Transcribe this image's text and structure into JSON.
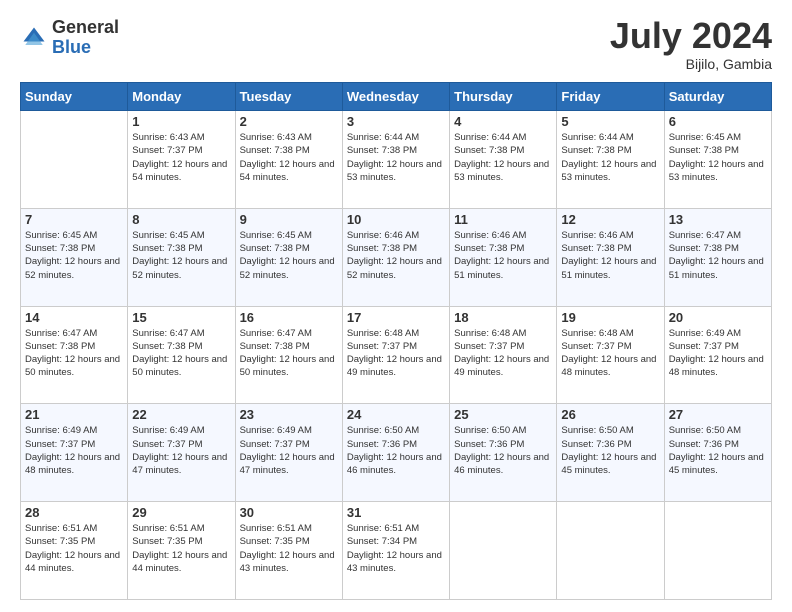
{
  "logo": {
    "general": "General",
    "blue": "Blue"
  },
  "header": {
    "title": "July 2024",
    "subtitle": "Bijilo, Gambia"
  },
  "days_of_week": [
    "Sunday",
    "Monday",
    "Tuesday",
    "Wednesday",
    "Thursday",
    "Friday",
    "Saturday"
  ],
  "weeks": [
    [
      {
        "day": "",
        "sunrise": "",
        "sunset": "",
        "daylight": ""
      },
      {
        "day": "1",
        "sunrise": "Sunrise: 6:43 AM",
        "sunset": "Sunset: 7:37 PM",
        "daylight": "Daylight: 12 hours and 54 minutes."
      },
      {
        "day": "2",
        "sunrise": "Sunrise: 6:43 AM",
        "sunset": "Sunset: 7:38 PM",
        "daylight": "Daylight: 12 hours and 54 minutes."
      },
      {
        "day": "3",
        "sunrise": "Sunrise: 6:44 AM",
        "sunset": "Sunset: 7:38 PM",
        "daylight": "Daylight: 12 hours and 53 minutes."
      },
      {
        "day": "4",
        "sunrise": "Sunrise: 6:44 AM",
        "sunset": "Sunset: 7:38 PM",
        "daylight": "Daylight: 12 hours and 53 minutes."
      },
      {
        "day": "5",
        "sunrise": "Sunrise: 6:44 AM",
        "sunset": "Sunset: 7:38 PM",
        "daylight": "Daylight: 12 hours and 53 minutes."
      },
      {
        "day": "6",
        "sunrise": "Sunrise: 6:45 AM",
        "sunset": "Sunset: 7:38 PM",
        "daylight": "Daylight: 12 hours and 53 minutes."
      }
    ],
    [
      {
        "day": "7",
        "sunrise": "Sunrise: 6:45 AM",
        "sunset": "Sunset: 7:38 PM",
        "daylight": "Daylight: 12 hours and 52 minutes."
      },
      {
        "day": "8",
        "sunrise": "Sunrise: 6:45 AM",
        "sunset": "Sunset: 7:38 PM",
        "daylight": "Daylight: 12 hours and 52 minutes."
      },
      {
        "day": "9",
        "sunrise": "Sunrise: 6:45 AM",
        "sunset": "Sunset: 7:38 PM",
        "daylight": "Daylight: 12 hours and 52 minutes."
      },
      {
        "day": "10",
        "sunrise": "Sunrise: 6:46 AM",
        "sunset": "Sunset: 7:38 PM",
        "daylight": "Daylight: 12 hours and 52 minutes."
      },
      {
        "day": "11",
        "sunrise": "Sunrise: 6:46 AM",
        "sunset": "Sunset: 7:38 PM",
        "daylight": "Daylight: 12 hours and 51 minutes."
      },
      {
        "day": "12",
        "sunrise": "Sunrise: 6:46 AM",
        "sunset": "Sunset: 7:38 PM",
        "daylight": "Daylight: 12 hours and 51 minutes."
      },
      {
        "day": "13",
        "sunrise": "Sunrise: 6:47 AM",
        "sunset": "Sunset: 7:38 PM",
        "daylight": "Daylight: 12 hours and 51 minutes."
      }
    ],
    [
      {
        "day": "14",
        "sunrise": "Sunrise: 6:47 AM",
        "sunset": "Sunset: 7:38 PM",
        "daylight": "Daylight: 12 hours and 50 minutes."
      },
      {
        "day": "15",
        "sunrise": "Sunrise: 6:47 AM",
        "sunset": "Sunset: 7:38 PM",
        "daylight": "Daylight: 12 hours and 50 minutes."
      },
      {
        "day": "16",
        "sunrise": "Sunrise: 6:47 AM",
        "sunset": "Sunset: 7:38 PM",
        "daylight": "Daylight: 12 hours and 50 minutes."
      },
      {
        "day": "17",
        "sunrise": "Sunrise: 6:48 AM",
        "sunset": "Sunset: 7:37 PM",
        "daylight": "Daylight: 12 hours and 49 minutes."
      },
      {
        "day": "18",
        "sunrise": "Sunrise: 6:48 AM",
        "sunset": "Sunset: 7:37 PM",
        "daylight": "Daylight: 12 hours and 49 minutes."
      },
      {
        "day": "19",
        "sunrise": "Sunrise: 6:48 AM",
        "sunset": "Sunset: 7:37 PM",
        "daylight": "Daylight: 12 hours and 48 minutes."
      },
      {
        "day": "20",
        "sunrise": "Sunrise: 6:49 AM",
        "sunset": "Sunset: 7:37 PM",
        "daylight": "Daylight: 12 hours and 48 minutes."
      }
    ],
    [
      {
        "day": "21",
        "sunrise": "Sunrise: 6:49 AM",
        "sunset": "Sunset: 7:37 PM",
        "daylight": "Daylight: 12 hours and 48 minutes."
      },
      {
        "day": "22",
        "sunrise": "Sunrise: 6:49 AM",
        "sunset": "Sunset: 7:37 PM",
        "daylight": "Daylight: 12 hours and 47 minutes."
      },
      {
        "day": "23",
        "sunrise": "Sunrise: 6:49 AM",
        "sunset": "Sunset: 7:37 PM",
        "daylight": "Daylight: 12 hours and 47 minutes."
      },
      {
        "day": "24",
        "sunrise": "Sunrise: 6:50 AM",
        "sunset": "Sunset: 7:36 PM",
        "daylight": "Daylight: 12 hours and 46 minutes."
      },
      {
        "day": "25",
        "sunrise": "Sunrise: 6:50 AM",
        "sunset": "Sunset: 7:36 PM",
        "daylight": "Daylight: 12 hours and 46 minutes."
      },
      {
        "day": "26",
        "sunrise": "Sunrise: 6:50 AM",
        "sunset": "Sunset: 7:36 PM",
        "daylight": "Daylight: 12 hours and 45 minutes."
      },
      {
        "day": "27",
        "sunrise": "Sunrise: 6:50 AM",
        "sunset": "Sunset: 7:36 PM",
        "daylight": "Daylight: 12 hours and 45 minutes."
      }
    ],
    [
      {
        "day": "28",
        "sunrise": "Sunrise: 6:51 AM",
        "sunset": "Sunset: 7:35 PM",
        "daylight": "Daylight: 12 hours and 44 minutes."
      },
      {
        "day": "29",
        "sunrise": "Sunrise: 6:51 AM",
        "sunset": "Sunset: 7:35 PM",
        "daylight": "Daylight: 12 hours and 44 minutes."
      },
      {
        "day": "30",
        "sunrise": "Sunrise: 6:51 AM",
        "sunset": "Sunset: 7:35 PM",
        "daylight": "Daylight: 12 hours and 43 minutes."
      },
      {
        "day": "31",
        "sunrise": "Sunrise: 6:51 AM",
        "sunset": "Sunset: 7:34 PM",
        "daylight": "Daylight: 12 hours and 43 minutes."
      },
      {
        "day": "",
        "sunrise": "",
        "sunset": "",
        "daylight": ""
      },
      {
        "day": "",
        "sunrise": "",
        "sunset": "",
        "daylight": ""
      },
      {
        "day": "",
        "sunrise": "",
        "sunset": "",
        "daylight": ""
      }
    ]
  ]
}
